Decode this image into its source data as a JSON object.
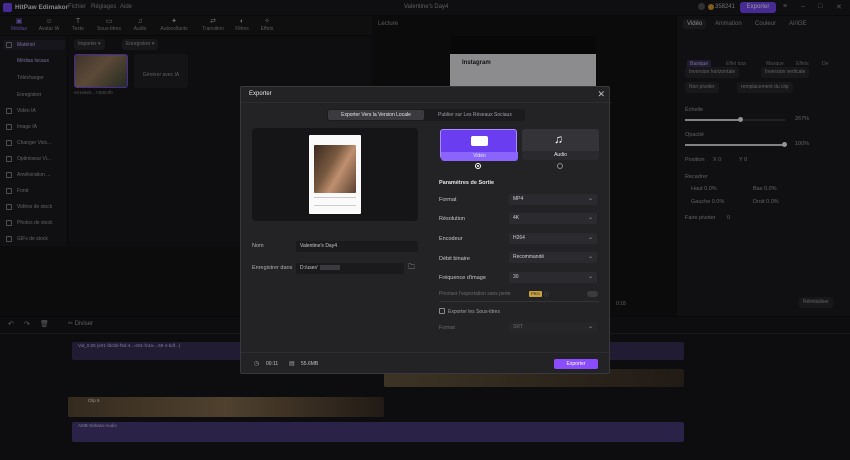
{
  "app": {
    "title": "HitPaw Edimakor",
    "menus": [
      "Fichier",
      "Réglages",
      "Aide"
    ],
    "window_title": "Valentine's Day4",
    "credits": "358241",
    "export_label": "Exporter"
  },
  "toolbar": {
    "items": [
      "Médias",
      "Avatar IA",
      "Texte",
      "Sous-titres",
      "Audio",
      "Autocollants",
      "Transition",
      "Filtres",
      "Effets"
    ]
  },
  "leftnav": {
    "items": [
      "Matériel",
      "Médias locaux",
      "Télécharger",
      "Enregistrer",
      "Vidéo IA",
      "Image IA",
      "Changer Voix...",
      "Optimiseur Vi...",
      "Amélioration ...",
      "Fond",
      "Vidéos de stock",
      "Photos de stock",
      "GIFs de stock"
    ]
  },
  "media": {
    "import_label": "Importer",
    "record_label": "Enregistrer",
    "clip_name": "e01e6eb...7480mfb",
    "ai_label": "Générer avec IA"
  },
  "preview": {
    "label": "Lecture",
    "insta": "Instagram",
    "time": "0:18"
  },
  "right": {
    "tabs": [
      "Vidéo",
      "Animation",
      "Couleur",
      "AI/IGE"
    ],
    "subtabs": [
      "Basique",
      "Effet tour",
      "Masque",
      "Effets",
      "De"
    ],
    "flip_h": "Inversion horizontale",
    "flip_v": "Inversion verticale",
    "freeze": "Non pivoter",
    "replace": "remplacement du clip",
    "scale_label": "Échelle",
    "scale_val": "267%",
    "opacity_label": "Opacité",
    "opacity_val": "100%",
    "position_label": "Position",
    "pos_x": "0",
    "pos_y": "0",
    "crop_label": "Recadrer",
    "top": "Haut",
    "bottom": "Bas",
    "left": "Gauche",
    "right": "Droit",
    "crop_val": "0.0%",
    "rotate_label": "Faire pivoter",
    "rotate_val": "0",
    "reset": "Réinitialiser"
  },
  "timeline": {
    "split_label": "Diviser",
    "clip1": "Vid_0.05 (e01-fdcbb-f5d-4...-e01-fc4a-...58-4-bdf...)",
    "clip2": "Clip 5",
    "audio": "AMB-Sahara-Audio"
  },
  "dialog": {
    "title": "Exporter",
    "tab_local": "Exporter Vers la Version Locale",
    "tab_social": "Publier sur Les Réseaux Sociaux",
    "name_label": "Nom",
    "name_value": "Valentine's Day4",
    "save_label": "Enregistrer dans",
    "save_value": "D:/user/",
    "video_label": "Vidéo",
    "audio_label": "Audio",
    "settings_title": "Paramètres de Sortie",
    "format_label": "Format",
    "format_value": "MP4",
    "res_label": "Résolution",
    "res_value": "4K",
    "enc_label": "Encodeur",
    "enc_value": "H264",
    "bitrate_label": "Débit binaire",
    "bitrate_value": "Recommandé",
    "fps_label": "Fréquence d'image",
    "fps_value": "30",
    "lossless_label": "Prioriser l'exportation sans perte",
    "lossless_badge": "PRO",
    "subtitle_label": "Exporter les Sous-titres",
    "sub_format_label": "Format",
    "sub_format_value": "SRT",
    "duration": "00:11",
    "size": "55.6MB",
    "export_btn": "Exporter"
  }
}
